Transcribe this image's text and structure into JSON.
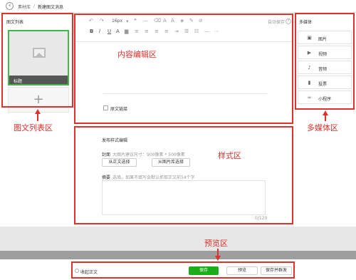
{
  "nav": {
    "back_glyph": "‹",
    "breadcrumb_root": "素材库",
    "separator": "/",
    "breadcrumb_current": "新建图文消息"
  },
  "article_list": {
    "title": "图文列表",
    "thumb_label": "标题",
    "add_glyph": "+"
  },
  "toolbar": {
    "undo": "↶",
    "redo": "↷",
    "font_size": "16px",
    "font_size_arrow": "▾",
    "quote": "❝",
    "hr": "—",
    "eraser": "⌫",
    "align_a": "A",
    "tool_a2": "A",
    "tool_fill": "◈",
    "tool_pen": "✎",
    "tool_link": "⊘",
    "bold": "B",
    "italic": "I",
    "underline": "U",
    "color_a": "A",
    "highlight": "▆",
    "align_left": "≡",
    "align_center": "≡",
    "align_right": "≡",
    "align_justify": "≡",
    "indent": "⇥",
    "list_ul": "☰",
    "list_ol": "☷",
    "line": "—",
    "more": "⋯",
    "autosave": "自动保存",
    "autosave_icon": "?"
  },
  "editor": {
    "original_checkbox_label": "原文链接"
  },
  "settings": {
    "title": "发布样式编辑",
    "cover_label": "封面",
    "cover_hint": "大图片建议尺寸：900像素 * 500像素",
    "from_body_btn": "从正文选择",
    "from_library_btn": "从图片库选择",
    "summary_label": "摘要",
    "summary_placeholder": "选填，如果不填写会默认抓取正文前54个字",
    "summary_counter": "0/120"
  },
  "media": {
    "title": "多媒体",
    "items": [
      {
        "icon": "▣",
        "label": "图片"
      },
      {
        "icon": "▶",
        "label": "视频"
      },
      {
        "icon": "♪",
        "label": "音频"
      },
      {
        "icon": "▮",
        "label": "投票"
      },
      {
        "icon": "∞",
        "label": "小程序"
      }
    ]
  },
  "footer": {
    "collapse_label": "收起正文",
    "save_btn": "保存",
    "preview_btn": "预览",
    "save_publish_btn": "保存并群发"
  },
  "annotations": {
    "list_area": "图文列表区",
    "content_area": "内容编辑区",
    "media_area": "多媒体区",
    "style_area": "样式区",
    "preview_area": "预览区"
  },
  "colors": {
    "annotation_red": "#e0312b",
    "save_green": "#1aad19",
    "select_green": "#44b549"
  }
}
